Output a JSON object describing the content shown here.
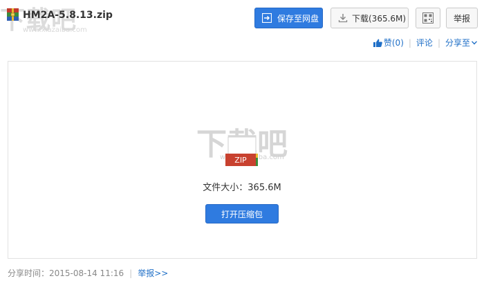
{
  "file": {
    "name": "HM2A-5.8.13.zip",
    "type_badge": "ZIP",
    "size_label": "文件大小：365.6M"
  },
  "toolbar": {
    "save_label": "保存至网盘",
    "download_label": "下载(365.6M)",
    "report_label": "举报"
  },
  "actions": {
    "like_label": "赞",
    "like_count": "(0)",
    "comment_label": "评论",
    "share_label": "分享至"
  },
  "watermark": {
    "text": "下载吧",
    "url": "www.xiazaiba.com"
  },
  "main": {
    "open_button_label": "打开压缩包"
  },
  "footer": {
    "share_time": "分享时间：2015-08-14 11:16",
    "report_link": "举报>>"
  },
  "colors": {
    "primary_button": "#2f7be0",
    "link": "#1f6fc7"
  }
}
